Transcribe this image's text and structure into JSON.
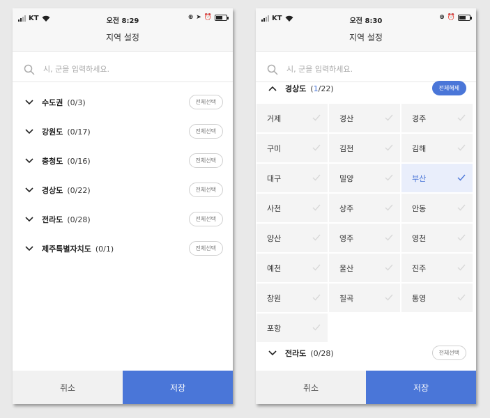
{
  "colors": {
    "accent": "#4a76d8",
    "selected_cell": "#e9eefb",
    "cell": "#f4f4f4"
  },
  "left": {
    "status": {
      "carrier": "KT",
      "time": "오전 8:29"
    },
    "title": "지역 설정",
    "search": {
      "placeholder": "시, 군을 입력하세요."
    },
    "regions": [
      {
        "name": "수도권",
        "count": "(0/3)",
        "action": "전체선택"
      },
      {
        "name": "강원도",
        "count": "(0/17)",
        "action": "전체선택"
      },
      {
        "name": "충청도",
        "count": "(0/16)",
        "action": "전체선택"
      },
      {
        "name": "경상도",
        "count": "(0/22)",
        "action": "전체선택"
      },
      {
        "name": "전라도",
        "count": "(0/28)",
        "action": "전체선택"
      },
      {
        "name": "제주특별자치도",
        "count": "(0/1)",
        "action": "전체선택"
      }
    ],
    "buttons": {
      "cancel": "취소",
      "save": "저장"
    }
  },
  "right": {
    "status": {
      "carrier": "KT",
      "time": "오전 8:30"
    },
    "title": "지역 설정",
    "search": {
      "placeholder": "시, 군을 입력하세요."
    },
    "expanded": {
      "name": "경상도",
      "count_selected": "1",
      "count_total": "/22",
      "action": "전체해제"
    },
    "cities": [
      {
        "name": "거제",
        "selected": false
      },
      {
        "name": "경산",
        "selected": false
      },
      {
        "name": "경주",
        "selected": false
      },
      {
        "name": "구미",
        "selected": false
      },
      {
        "name": "김천",
        "selected": false
      },
      {
        "name": "김해",
        "selected": false
      },
      {
        "name": "대구",
        "selected": false
      },
      {
        "name": "밀양",
        "selected": false
      },
      {
        "name": "부산",
        "selected": true
      },
      {
        "name": "사천",
        "selected": false
      },
      {
        "name": "상주",
        "selected": false
      },
      {
        "name": "안동",
        "selected": false
      },
      {
        "name": "양산",
        "selected": false
      },
      {
        "name": "영주",
        "selected": false
      },
      {
        "name": "영천",
        "selected": false
      },
      {
        "name": "예천",
        "selected": false
      },
      {
        "name": "울산",
        "selected": false
      },
      {
        "name": "진주",
        "selected": false
      },
      {
        "name": "창원",
        "selected": false
      },
      {
        "name": "칠곡",
        "selected": false
      },
      {
        "name": "통영",
        "selected": false
      },
      {
        "name": "포항",
        "selected": false
      }
    ],
    "next_region": {
      "name": "전라도",
      "count": "(0/28)",
      "action": "전체선택"
    },
    "buttons": {
      "cancel": "취소",
      "save": "저장"
    }
  }
}
